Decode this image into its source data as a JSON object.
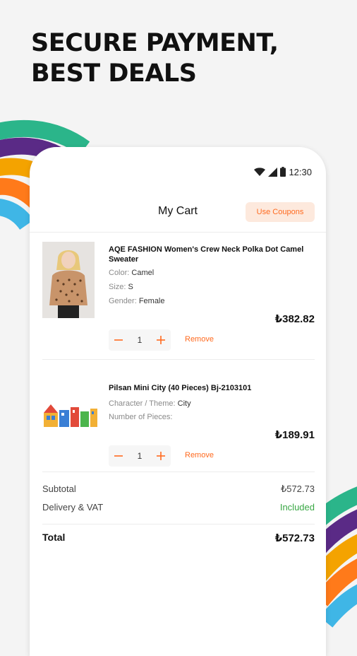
{
  "headline": {
    "line1": "SECURE PAYMENT,",
    "line2": "BEST DEALS"
  },
  "status_bar": {
    "time": "12:30"
  },
  "header": {
    "title": "My Cart",
    "coupon_button": "Use Coupons"
  },
  "cart": {
    "items": [
      {
        "name": "AQE FASHION Women's Crew Neck Polka Dot Camel Sweater",
        "attr1_label": "Color:",
        "attr1_value": "Camel",
        "attr2_label": "Size:",
        "attr2_value": "S",
        "attr3_label": "Gender:",
        "attr3_value": "Female",
        "price": "₺382.82",
        "quantity": "1",
        "remove_label": "Remove"
      },
      {
        "name": "Pilsan Mini City (40 Pieces) Bj-2103101",
        "attr1_label": "Character / Theme:",
        "attr1_value": "City",
        "attr2_label": "Number of Pieces:",
        "attr2_value": "",
        "price": "₺189.91",
        "quantity": "1",
        "remove_label": "Remove"
      }
    ]
  },
  "summary": {
    "subtotal_label": "Subtotal",
    "subtotal_value": "₺572.73",
    "delivery_label": "Delivery & VAT",
    "delivery_value": "Included",
    "total_label": "Total",
    "total_value": "₺572.73"
  },
  "colors": {
    "accent": "#ff6a1f",
    "accent_soft": "#fde9dd",
    "included_green": "#3aa845",
    "stripe_teal": "#2bb58a",
    "stripe_purple": "#5a2a86",
    "stripe_orange": "#ff7a1a",
    "stripe_amber": "#f4a300",
    "stripe_blue": "#3fb6e6"
  }
}
